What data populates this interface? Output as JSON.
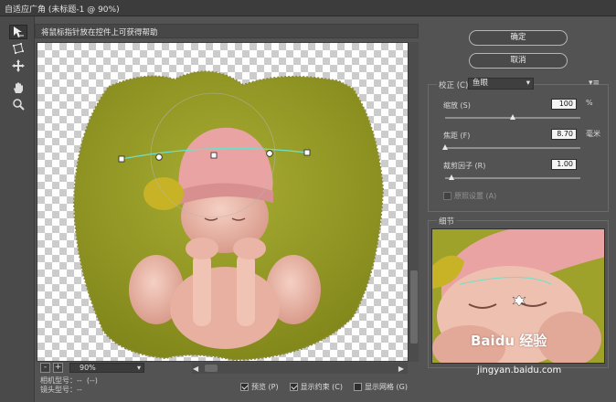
{
  "window": {
    "title": "自适应广角 (未标题-1 @ 90%)"
  },
  "toolbar": {
    "tools": [
      "constraint-tool-icon",
      "polygon-constraint-tool-icon",
      "move-tool-icon",
      "hand-tool-icon",
      "zoom-tool-icon"
    ]
  },
  "hint": {
    "text": "将鼠标指针放在控件上可获得帮助"
  },
  "zoom": {
    "value": "90%",
    "minus": "-",
    "plus": "+"
  },
  "lens_info": {
    "camera": "相机型号：--  (--)",
    "lens": "镜头型号：--"
  },
  "bottom_checks": [
    {
      "label": "预览 (P)",
      "checked": true
    },
    {
      "label": "显示约束 (C)",
      "checked": true
    },
    {
      "label": "显示网格 (G)",
      "checked": false
    }
  ],
  "buttons": {
    "ok": "确定",
    "cancel": "取消"
  },
  "correction": {
    "label": "校正 (C):",
    "value": "鱼眼",
    "menu_icon": "panel-menu-icon",
    "scale": {
      "label": "缩放 (S)",
      "value": "100",
      "unit": "%",
      "level": 0.5
    },
    "focal": {
      "label": "焦距 (F)",
      "value": "8.70",
      "unit": "毫米",
      "level": 0.0
    },
    "crop": {
      "label": "裁剪因子 (R)",
      "value": "1.00",
      "level": 0.05
    },
    "as_shot": {
      "label": "原照设置 (A)",
      "checked": false,
      "disabled": true
    }
  },
  "detail": {
    "label": "细节"
  },
  "watermark": {
    "brand": "Baidu 经验",
    "url": "jingyan.baidu.com"
  },
  "colors": {
    "background": "#535353",
    "constraint_line": "#6fe0c8",
    "backdrop": "#9ea22a"
  }
}
